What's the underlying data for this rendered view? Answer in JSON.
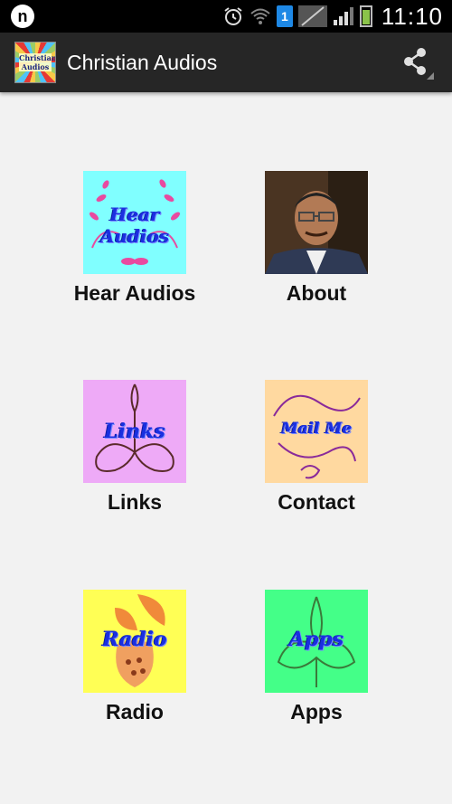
{
  "status_bar": {
    "notification_letter": "n",
    "sim_badge": "1",
    "time": "11:10"
  },
  "action_bar": {
    "title": "Christian Audios",
    "logo_text": "Christian Audios",
    "share_icon": "share-icon"
  },
  "tiles": [
    {
      "label": "Hear Audios",
      "image_text_1": "Hear",
      "image_text_2": "Audios",
      "bg": "#80ffff"
    },
    {
      "label": "About",
      "bg": "#3a2a1c"
    },
    {
      "label": "Links",
      "image_text": "Links",
      "bg": "#eeaaf7"
    },
    {
      "label": "Contact",
      "image_text": "Mail  Me",
      "bg": "#ffd9a0"
    },
    {
      "label": "Radio",
      "image_text": "Radio",
      "bg": "#ffff55"
    },
    {
      "label": "Apps",
      "image_text": "Apps",
      "bg": "#44ff88"
    }
  ],
  "colors": {
    "status_bar": "#000000",
    "action_bar": "#262626",
    "background": "#f2f2f2",
    "image_text": "#1a2fe0"
  }
}
